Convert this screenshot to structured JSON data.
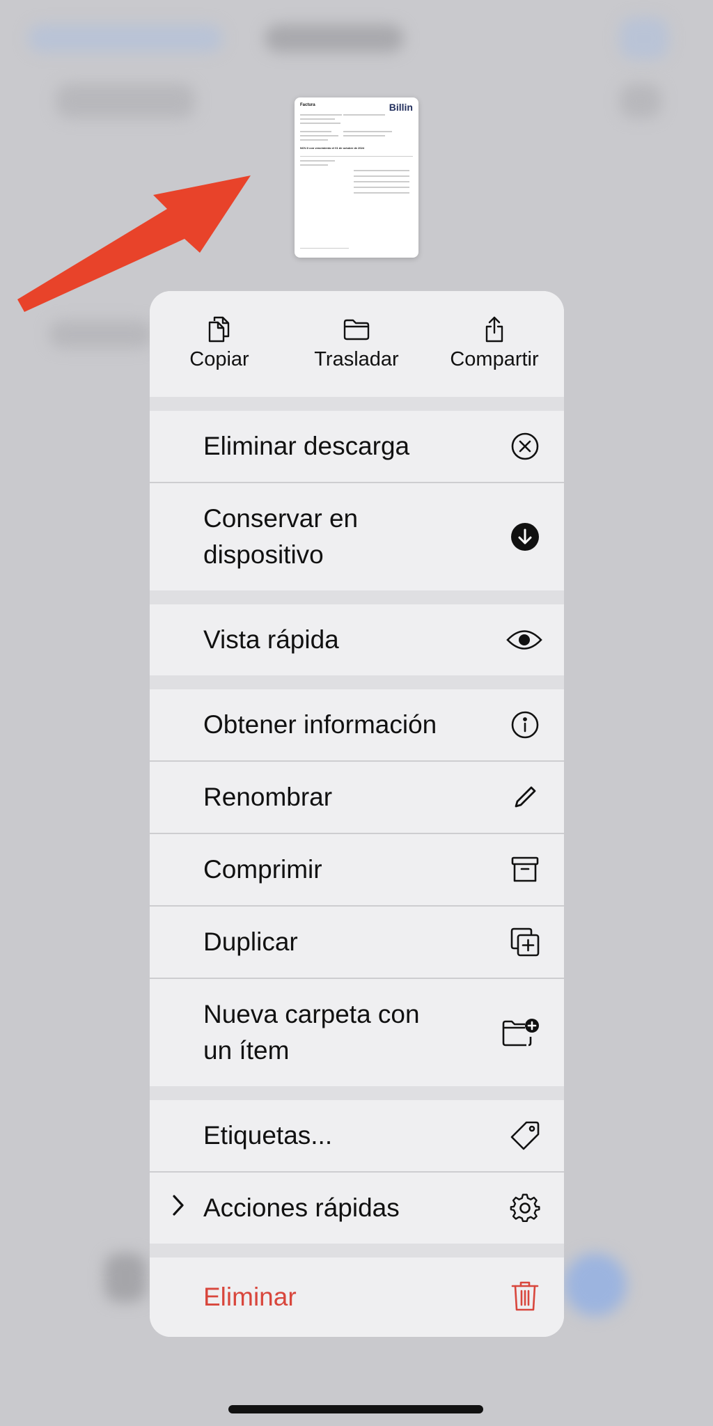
{
  "document_thumbnail": {
    "title": "Factura",
    "logo": "Billin",
    "heading": "NOV-0 con vencimiento el 01 de octubre de 2024"
  },
  "top_actions": [
    {
      "label": "Copiar",
      "icon": "copy-icon"
    },
    {
      "label": "Trasladar",
      "icon": "folder-icon"
    },
    {
      "label": "Compartir",
      "icon": "share-icon"
    }
  ],
  "menu": {
    "remove_download": "Eliminar descarga",
    "keep_on_device": "Conservar en\ndispositivo",
    "quick_look": "Vista rápida",
    "get_info": "Obtener información",
    "rename": "Renombrar",
    "compress": "Comprimir",
    "duplicate": "Duplicar",
    "new_folder_with_item": "Nueva carpeta con\nun ítem",
    "tags": "Etiquetas...",
    "quick_actions": "Acciones rápidas",
    "delete": "Eliminar"
  },
  "colors": {
    "annotation_arrow": "#e8432a",
    "danger": "#d8463c"
  }
}
